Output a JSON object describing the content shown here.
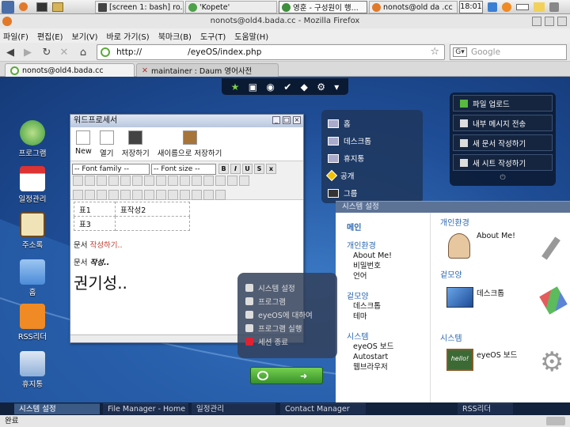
{
  "os_taskbar": {
    "items": [
      {
        "label": "[screen 1: bash] ro..."
      },
      {
        "label": "'Kopete'"
      },
      {
        "label": "영훈 - 구성원이 행..."
      },
      {
        "label": "nonots@old  da  .cc"
      }
    ],
    "clock": "18:01"
  },
  "browser": {
    "window_title": "nonots@old4.bada.cc - Mozilla Firefox",
    "menu": [
      "파일(F)",
      "편집(E)",
      "보기(V)",
      "바로 가기(S)",
      "북마크(B)",
      "도구(T)",
      "도움말(H)"
    ],
    "url": {
      "scheme": "http://",
      "path": "/eyeOS/index.php"
    },
    "search_placeholder": "Google",
    "tabs": [
      {
        "label": "nonots@old4.bada.cc"
      },
      {
        "label": "maintainer : Daum 영어사전"
      }
    ],
    "status": "완료"
  },
  "desktop_icons": [
    {
      "label": "프로그램"
    },
    {
      "label": "일정관리"
    },
    {
      "label": "주소록"
    },
    {
      "label": "홈"
    },
    {
      "label": "RSS리더"
    },
    {
      "label": "휴지통"
    }
  ],
  "word_processor": {
    "title": "워드프로세서",
    "toolbar": [
      "New",
      "열기",
      "저장하기",
      "새이름으로 저장하기"
    ],
    "font_family": "-- Font family --",
    "font_size": "-- Font size --",
    "table": [
      [
        "표1",
        "표작성2"
      ],
      [
        "표3",
        ""
      ]
    ],
    "lines": [
      {
        "prefix": "문서 ",
        "styled": "작성하기.."
      },
      {
        "prefix": "문서 ",
        "styled": "작성.."
      }
    ],
    "big_text": "권기성.."
  },
  "places_menu": [
    "홈",
    "데스크톱",
    "휴지통",
    "공개",
    "그룹"
  ],
  "quick_panel": [
    "파일 업로드",
    "내부 메시지 전송",
    "새 문서 작성하기",
    "새 시트 작성하기"
  ],
  "settings": {
    "title": "시스템 설정",
    "main_header": "메인",
    "sections": [
      {
        "header": "개인환경",
        "items": [
          "About Me!",
          "비밀번호",
          "언어"
        ]
      },
      {
        "header": "겉모양",
        "items": [
          "데스크톱",
          "테마"
        ]
      },
      {
        "header": "시스템",
        "items": [
          "eyeOS 보드",
          "Autostart",
          "웹브라우저"
        ]
      }
    ],
    "right_sections": [
      {
        "header": "개인환경",
        "item": "About Me!"
      },
      {
        "header": "겉모양",
        "item": "데스크톱"
      },
      {
        "header": "시스템",
        "item": "eyeOS 보드"
      }
    ],
    "hello_label": "hello!"
  },
  "system_menu": [
    "시스템 설정",
    "프로그램",
    "eyeOS에 대하여",
    "프로그램 실행",
    "세션 종료"
  ],
  "bottom_taskbar": [
    "시스템 설정",
    "File Manager - Home",
    "일정관리",
    "Contact Manager",
    "RSS리더"
  ]
}
